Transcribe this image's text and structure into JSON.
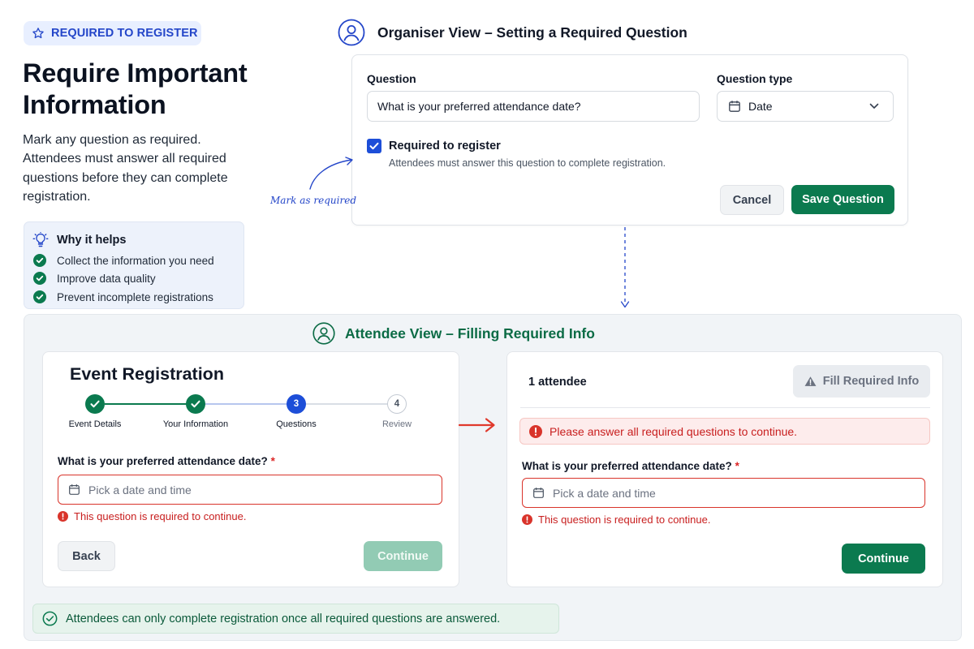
{
  "badge": {
    "label": "REQUIRED TO REGISTER",
    "icon": "star-icon"
  },
  "hero": {
    "title": "Require Important Information",
    "description": "Mark any question as required. Attendees must answer all required questions before they can complete registration."
  },
  "why": {
    "title": "Why it helps",
    "items": [
      "Collect the information you need",
      "Improve data quality",
      "Prevent incomplete registrations"
    ]
  },
  "organiser": {
    "heading": "Organiser View – Setting a Required Question",
    "question_label": "Question",
    "question_value": "What is your preferred attendance date?",
    "type_label": "Question type",
    "type_value": "Date",
    "required_label": "Required to register",
    "required_checked": true,
    "required_help": "Attendees must answer this question to complete registration.",
    "annotation": "Mark as required",
    "cancel_label": "Cancel",
    "save_label": "Save Question"
  },
  "attendee": {
    "heading": "Attendee View – Filling Required Info",
    "left": {
      "title": "Event Registration",
      "steps": [
        {
          "number": "1",
          "label": "Event Details",
          "state": "done"
        },
        {
          "number": "2",
          "label": "Your Information",
          "state": "done"
        },
        {
          "number": "3",
          "label": "Questions",
          "state": "current"
        },
        {
          "number": "4",
          "label": "Review",
          "state": "upcoming"
        }
      ],
      "question": "What is your preferred attendance date?",
      "required_mark": "*",
      "placeholder": "Pick a date and time",
      "error": "This question is required to continue.",
      "back_label": "Back",
      "continue_label": "Continue"
    },
    "right": {
      "count": "1 attendee",
      "fill_label": "Fill Required Info",
      "alert": "Please answer all required questions to continue.",
      "question": "What is your preferred attendance date?",
      "required_mark": "*",
      "placeholder": "Pick a date and time",
      "error": "This question is required to continue.",
      "continue_label": "Continue"
    }
  },
  "footer_note": "Attendees can only complete registration once all required questions are answered.",
  "colors": {
    "primary_blue": "#2446c9",
    "green": "#0b7a4f",
    "error_red": "#d9342b"
  }
}
